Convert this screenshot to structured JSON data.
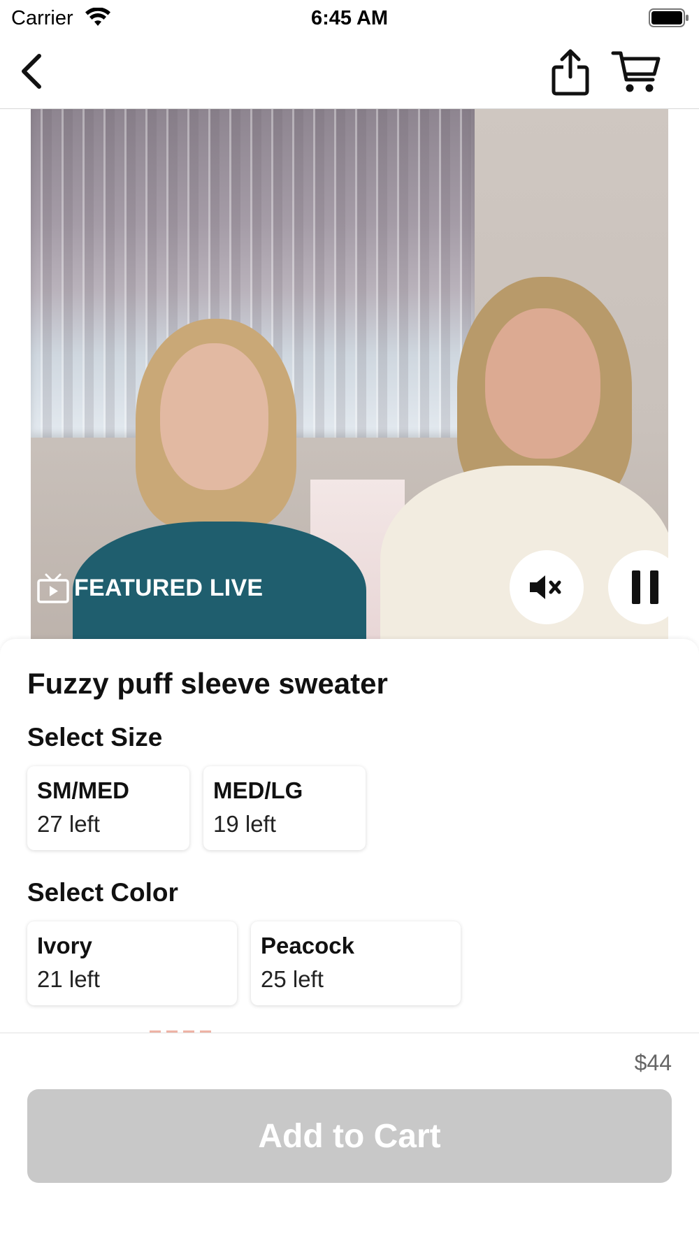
{
  "status_bar": {
    "carrier": "Carrier",
    "time": "6:45 AM"
  },
  "nav": {
    "back_icon": "chevron-left-icon",
    "share_icon": "share-icon",
    "cart_icon": "cart-icon"
  },
  "video": {
    "badge_icon": "tv-icon",
    "badge_label": "FEATURED LIVE",
    "mute_icon": "mute-icon",
    "pause_icon": "pause-icon"
  },
  "product": {
    "title": "Fuzzy puff sleeve sweater",
    "size_label": "Select Size",
    "sizes": [
      {
        "name": "SM/MED",
        "stock": "27 left"
      },
      {
        "name": "MED/LG",
        "stock": "19 left"
      }
    ],
    "color_label": "Select Color",
    "colors": [
      {
        "name": "Ivory",
        "stock": "21 left"
      },
      {
        "name": "Peacock",
        "stock": "25 left"
      }
    ]
  },
  "footer": {
    "price": "$44",
    "add_to_cart_label": "Add to Cart"
  },
  "colors": {
    "button_disabled": "#c8c8c8",
    "price_text": "#666666"
  }
}
